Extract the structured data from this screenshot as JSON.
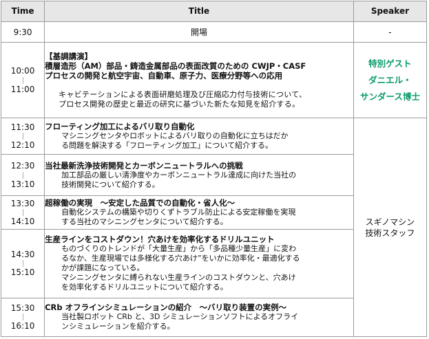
{
  "header": {
    "time": "Time",
    "title": "Title",
    "speaker": "Speaker"
  },
  "opening": {
    "time": "9:30",
    "title": "開場",
    "speaker": "-"
  },
  "keynote": {
    "start": "10:00",
    "end": "11:00",
    "label": "【基調講演】",
    "title_line1": "積層造形（AM）部品・鋳造金属部品の表面改質のための CWJP・CASF",
    "title_line2": "プロセスの開発と航空宇宙、自動車、原子力、医療分野等への応用",
    "desc_line1": "キャビテーションによる表面研磨処理及び圧縮応力付与技術について、",
    "desc_line2": "プロセス開発の歴史と最近の研究に基づいた新たな知見を紹介する。",
    "speaker_line1": "特別ゲスト",
    "speaker_line2": "ダニエル・",
    "speaker_line3": "サンダース博士"
  },
  "sessions": [
    {
      "start": "11:30",
      "end": "12:10",
      "title": "フローティング加工によるバリ取り自動化",
      "desc": [
        "マシニングセンタやロボットによるバリ取りの自動化に立ちはだか",
        "る問題を解決する「フローティング加工」について紹介する。"
      ]
    },
    {
      "start": "12:30",
      "end": "13:10",
      "title": "当社最新洗浄技術開発とカーボンニュートラルへの挑戦",
      "desc": [
        "加工部品の厳しい清浄度やカーボンニュートラル達成に向けた当社の",
        "技術開発について紹介する。"
      ]
    },
    {
      "start": "13:30",
      "end": "14:10",
      "title": "超稼働の実現　～安定した品質での自動化・省人化～",
      "desc": [
        "自動化システムの構築や切りくずトラブル防止による安定稼働を実現",
        "する当社のマシニングセンタについて紹介する。"
      ]
    },
    {
      "start": "14:30",
      "end": "15:10",
      "title": "生産ラインをコストダウン！穴あけを効率化するドリルユニット",
      "desc": [
        "ものづくりのトレンドが「大量生産」から「多品種少量生産」に変わ",
        "るなか、生産現場では多様化する穴あけ”をいかに効率化・最適化する",
        "かが課題になっている。",
        "マシニングセンタに縛られない生産ラインのコストダウンと、穴あけ",
        "を効率化するドリルユニットについて紹介する。"
      ]
    },
    {
      "start": "15:30",
      "end": "16:10",
      "title": "CRb オフラインシミュレーションの紹介　～バリ取り装置の実例～",
      "desc": [
        "当社製ロボット CRb と、3D シミュレーションソフトによるオフライ",
        "ンシミュレーションを紹介する。"
      ]
    }
  ],
  "staff_speaker": {
    "line1": "スギノマシン",
    "line2": "技術スタッフ"
  }
}
